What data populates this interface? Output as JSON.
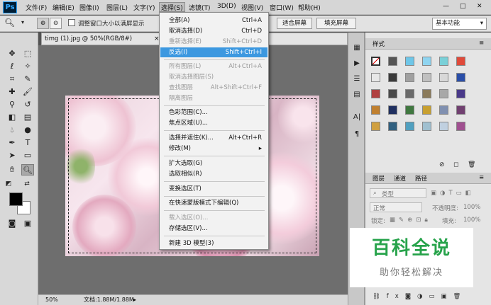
{
  "app": {
    "logo": "Ps"
  },
  "menubar": {
    "items": [
      "文件(F)",
      "编辑(E)",
      "图像(I)",
      "图层(L)",
      "文字(Y)",
      "选择(S)",
      "滤镜(T)",
      "3D(D)",
      "视图(V)",
      "窗口(W)",
      "帮助(H)"
    ],
    "active_index": 5,
    "minimize": "—",
    "maximize": "□",
    "close": "✕"
  },
  "options": {
    "tool_icon": "zoom-icon",
    "resize_windows_label": "调整窗口大小以满屏显示",
    "fit_screen_label": "适合屏幕",
    "fill_screen_label": "填充屏幕",
    "workspace": "基本功能"
  },
  "document": {
    "tab_title": "timg (1).jpg @ 50%(RGB/8#)",
    "close": "×",
    "zoom": "50%",
    "doc_info": "文档:1.88M/1.88M"
  },
  "select_menu": {
    "items": [
      {
        "label": "全部(A)",
        "shortcut": "Ctrl+A",
        "state": "normal"
      },
      {
        "label": "取消选择(D)",
        "shortcut": "Ctrl+D",
        "state": "normal"
      },
      {
        "label": "重新选择(E)",
        "shortcut": "Shift+Ctrl+D",
        "state": "disabled"
      },
      {
        "label": "反选(I)",
        "shortcut": "Shift+Ctrl+I",
        "state": "highlighted"
      },
      {
        "label": "所有图层(L)",
        "shortcut": "Alt+Ctrl+A",
        "state": "disabled"
      },
      {
        "label": "取消选择图层(S)",
        "shortcut": "",
        "state": "disabled"
      },
      {
        "label": "查找图层",
        "shortcut": "Alt+Shift+Ctrl+F",
        "state": "disabled"
      },
      {
        "label": "隔离图层",
        "shortcut": "",
        "state": "disabled"
      },
      {
        "label": "色彩范围(C)...",
        "shortcut": "",
        "state": "normal"
      },
      {
        "label": "焦点区域(U)...",
        "shortcut": "",
        "state": "normal"
      },
      {
        "label": "选择并遮住(K)...",
        "shortcut": "Alt+Ctrl+R",
        "state": "normal"
      },
      {
        "label": "修改(M)",
        "shortcut": "▸",
        "state": "normal"
      },
      {
        "label": "扩大选取(G)",
        "shortcut": "",
        "state": "normal"
      },
      {
        "label": "选取相似(R)",
        "shortcut": "",
        "state": "normal"
      },
      {
        "label": "变换选区(T)",
        "shortcut": "",
        "state": "normal"
      },
      {
        "label": "在快速蒙版模式下编辑(Q)",
        "shortcut": "",
        "state": "normal"
      },
      {
        "label": "载入选区(O)...",
        "shortcut": "",
        "state": "disabled"
      },
      {
        "label": "存储选区(V)...",
        "shortcut": "",
        "state": "normal"
      },
      {
        "label": "新建 3D 模型(3)",
        "shortcut": "",
        "state": "normal"
      }
    ]
  },
  "styles_panel": {
    "tab": "样式"
  },
  "layers_panel": {
    "tabs": [
      "图层",
      "通道",
      "路径"
    ],
    "filter_label": "类型",
    "blend_mode": "正常",
    "opacity_label": "不透明度:",
    "opacity_value": "100%",
    "lock_label": "锁定:",
    "fill_label": "填充:",
    "fill_value": "100%"
  },
  "watermark": {
    "title": "百科全说",
    "subtitle": "助你轻松解决"
  },
  "colors": {
    "menu_highlight": "#3c98e0",
    "watermark_green": "#27a34b",
    "ps_blue": "#31a8ff"
  }
}
